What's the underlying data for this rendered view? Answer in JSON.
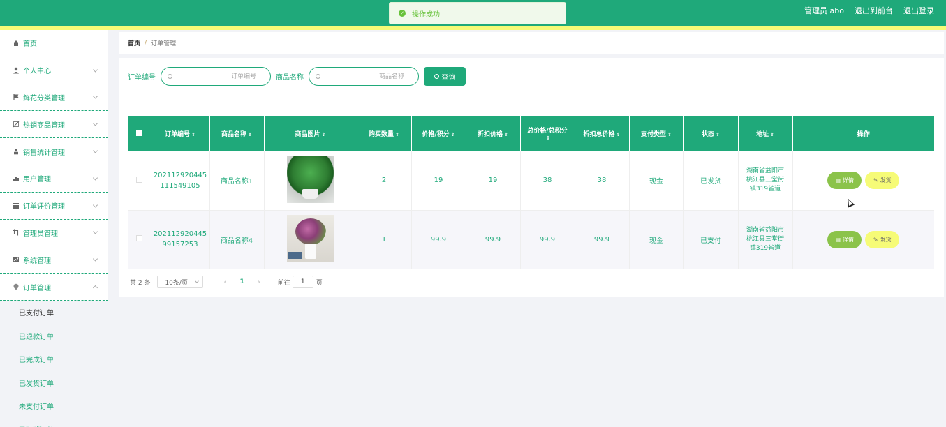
{
  "header": {
    "admin_label": "管理员 abo",
    "front_label": "退出到前台",
    "logout_label": "退出登录",
    "toast": "操作成功"
  },
  "sidebar": {
    "items": [
      {
        "label": "首页",
        "icon": "home-icon"
      },
      {
        "label": "个人中心",
        "icon": "user-icon"
      },
      {
        "label": "鲜花分类管理",
        "icon": "flag-icon"
      },
      {
        "label": "热销商品管理",
        "icon": "tag-icon"
      },
      {
        "label": "销售统计管理",
        "icon": "user-card-icon"
      },
      {
        "label": "用户管理",
        "icon": "bar-chart-icon"
      },
      {
        "label": "订单评价管理",
        "icon": "grid-icon"
      },
      {
        "label": "管理员管理",
        "icon": "crop-icon"
      },
      {
        "label": "系统管理",
        "icon": "line-chart-icon"
      },
      {
        "label": "订单管理",
        "icon": "pin-icon"
      }
    ],
    "sub_items": [
      "已支付订单",
      "已退款订单",
      "已完成订单",
      "已发货订单",
      "未支付订单",
      "已取消订单"
    ]
  },
  "breadcrumb": {
    "home": "首页",
    "separator": "/",
    "current": "订单管理"
  },
  "search": {
    "order_label": "订单编号",
    "order_placeholder": "订单编号",
    "product_label": "商品名称",
    "product_placeholder": "商品名称",
    "query_label": "查询"
  },
  "table": {
    "columns": [
      "订单编号",
      "商品名称",
      "商品图片",
      "购买数量",
      "价格/积分",
      "折扣价格",
      "总价格/总积分",
      "折扣总价格",
      "支付类型",
      "状态",
      "地址",
      "操作"
    ],
    "rows": [
      {
        "order_no_a": "202112920445",
        "order_no_b": "111549105",
        "product": "商品名称1",
        "image_icon": "green-plant-image",
        "qty": "2",
        "price": "19",
        "discount_price": "19",
        "total": "38",
        "discount_total": "38",
        "pay_type": "现金",
        "status": "已发货",
        "addr_a": "湖南省益阳市",
        "addr_b": "桃江县三堂街",
        "addr_c": "镇319省道"
      },
      {
        "order_no_a": "202112920445",
        "order_no_b": "99157253",
        "product": "商品名称4",
        "image_icon": "flower-bouquet-image",
        "qty": "1",
        "price": "99.9",
        "discount_price": "99.9",
        "total": "99.9",
        "discount_total": "99.9",
        "pay_type": "现金",
        "status": "已支付",
        "addr_a": "湖南省益阳市",
        "addr_b": "桃江县三堂街",
        "addr_c": "镇319省道"
      }
    ],
    "detail_label": "详情",
    "ship_label": "发货"
  },
  "pager": {
    "total": "共 2 条",
    "page_size": "10条/页",
    "current_page": "1",
    "goto_label": "前往",
    "goto_value": "1",
    "page_unit": "页"
  },
  "colors": {
    "primary": "#1fa97a",
    "accent_yellow": "#f6fb77",
    "detail_green": "#8bc34a"
  }
}
